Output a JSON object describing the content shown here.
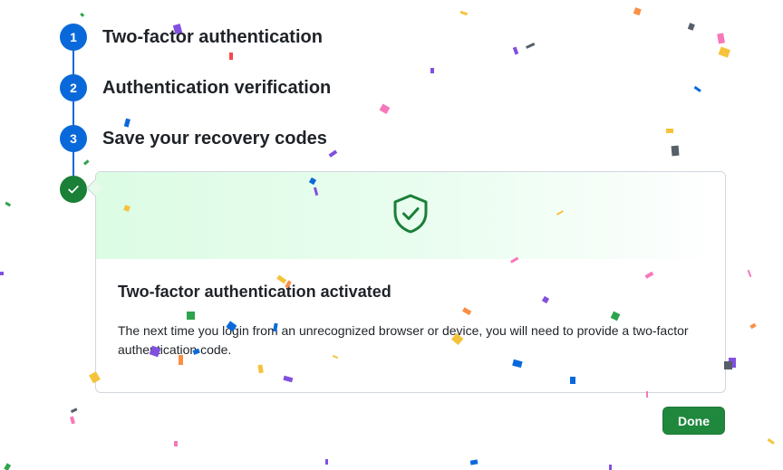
{
  "steps": [
    {
      "number": "1",
      "title": "Two-factor authentication"
    },
    {
      "number": "2",
      "title": "Authentication verification"
    },
    {
      "number": "3",
      "title": "Save your recovery codes"
    }
  ],
  "completion": {
    "icon": "check-icon",
    "heading": "Two-factor authentication activated",
    "message": "The next time you login from an unrecognized browser or device, you will need to provide a two-factor authentication code.",
    "banner_icon": "shield-check-icon"
  },
  "done_button": {
    "label": "Done"
  },
  "colors": {
    "step_blue": "#0969da",
    "success_green": "#1a7f37",
    "button_green": "#1f883d"
  }
}
